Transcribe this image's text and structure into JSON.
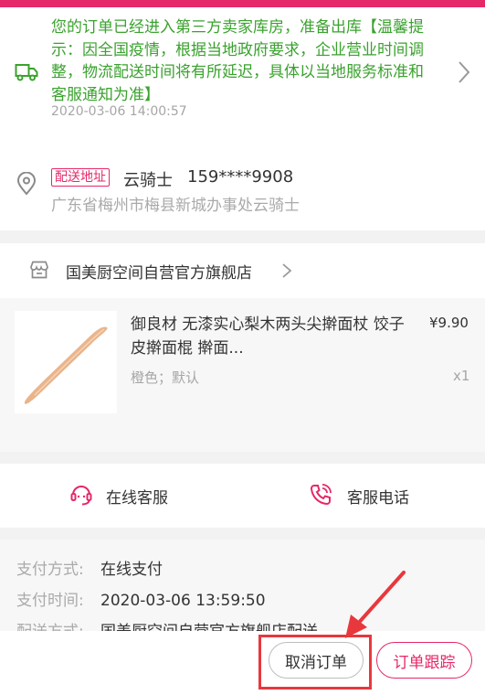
{
  "logistics": {
    "message": "您的订单已经进入第三方卖家库房，准备出库【温馨提示：因全国疫情，根据当地政府要求，企业营业时间调整，物流配送时间将有所延迟，具体以当地服务标准和客服通知为准】",
    "time": "2020-03-06 14:00:57"
  },
  "address": {
    "tag": "配送地址",
    "name": "云骑士",
    "phone": "159****9908",
    "detail": "广东省梅州市梅县新城办事处云骑士"
  },
  "store": {
    "name": "国美厨空间自营官方旗舰店"
  },
  "product": {
    "title": "御良材 无漆实心梨木两头尖擀面杖 饺子皮擀面棍 擀面...",
    "price": "¥9.90",
    "spec": "橙色；默认",
    "qty": "x1"
  },
  "service": {
    "chat_label": "在线客服",
    "phone_label": "客服电话"
  },
  "payment": {
    "rows": [
      {
        "key": "支付方式:",
        "value": "在线支付"
      },
      {
        "key": "支付时间:",
        "value": "2020-03-06 13:59:50"
      },
      {
        "key": "配送方式:",
        "value": "国美厨空间自营官方旗舰店配送"
      }
    ]
  },
  "actions": {
    "cancel_label": "取消订单",
    "track_label": "订单跟踪"
  },
  "colors": {
    "accent": "#e5286a",
    "logistics_text": "#3aa22e",
    "annotation": "#e8383d"
  }
}
